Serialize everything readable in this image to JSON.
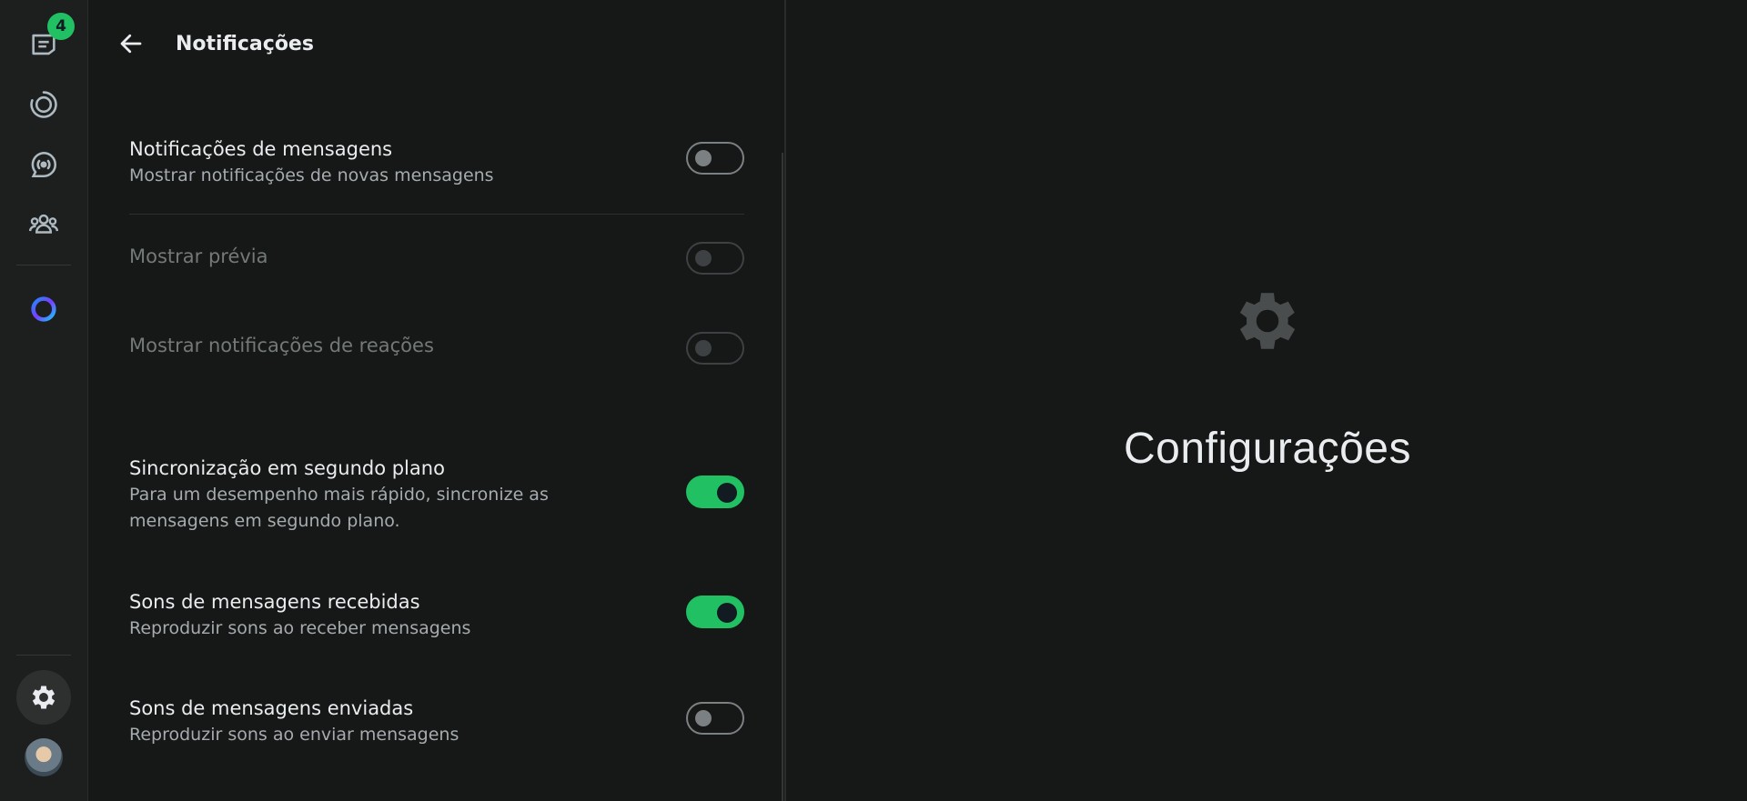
{
  "rail": {
    "chats_badge": "4",
    "items": [
      {
        "name": "chats",
        "icon": "chats-icon"
      },
      {
        "name": "status",
        "icon": "status-icon"
      },
      {
        "name": "channels",
        "icon": "channels-icon"
      },
      {
        "name": "communities",
        "icon": "communities-icon"
      },
      {
        "name": "meta-ai",
        "icon": "meta-ai-icon"
      },
      {
        "name": "settings",
        "icon": "gear-icon",
        "active": true
      },
      {
        "name": "profile",
        "icon": "avatar"
      }
    ],
    "accent": "#21c063"
  },
  "panel": {
    "title": "Notificações",
    "settings": [
      {
        "title": "Notificações de mensagens",
        "description": "Mostrar notificações de novas mensagens",
        "enabled": false,
        "disabled": false
      },
      {
        "title": "Mostrar prévia",
        "description": "",
        "enabled": false,
        "disabled": true
      },
      {
        "title": "Mostrar notificações de reações",
        "description": "",
        "enabled": false,
        "disabled": true
      },
      {
        "title": "Sincronização em segundo plano",
        "description": "Para um desempenho mais rápido, sincronize as mensagens em segundo plano.",
        "enabled": true,
        "disabled": false
      },
      {
        "title": "Sons de mensagens recebidas",
        "description": "Reproduzir sons ao receber mensagens",
        "enabled": true,
        "disabled": false
      },
      {
        "title": "Sons de mensagens enviadas",
        "description": "Reproduzir sons ao enviar mensagens",
        "enabled": false,
        "disabled": false
      }
    ]
  },
  "main": {
    "icon": "gear-icon",
    "title": "Configurações"
  }
}
